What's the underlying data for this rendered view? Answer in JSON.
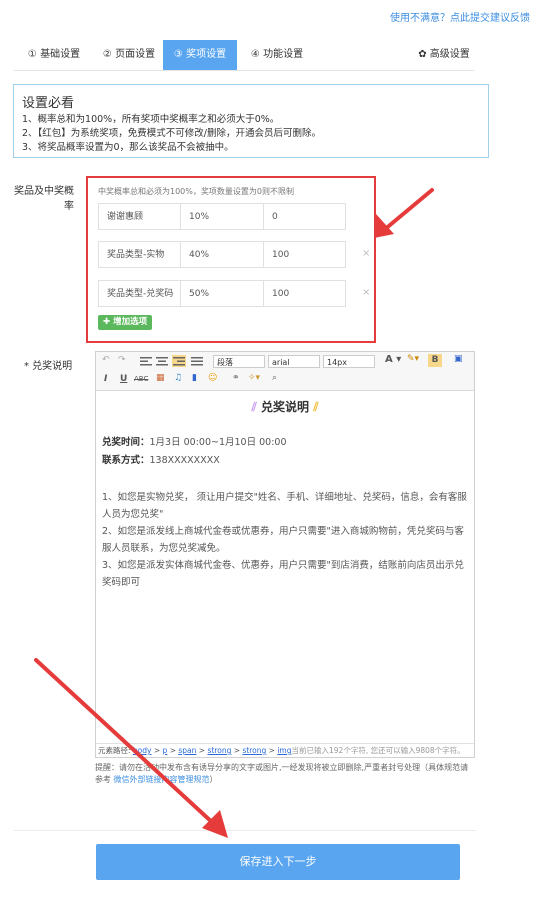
{
  "feedback_link": "使用不满意？点此提交建议反馈",
  "tabs": [
    {
      "label": "① 基础设置"
    },
    {
      "label": "② 页面设置"
    },
    {
      "label": "③ 奖项设置"
    },
    {
      "label": "④ 功能设置"
    }
  ],
  "advanced_tab": "✿ 高级设置",
  "notice": {
    "title": "设置必看",
    "lines": [
      "1、概率总和为100%，所有奖项中奖概率之和必须大于0%。",
      "2、【红包】为系统奖项，免费模式不可修改/删除，开通会员后可删除。",
      "3、将奖品概率设置为0，那么该奖品不会被抽中。"
    ]
  },
  "prize_section": {
    "label_line1": "奖品及中奖概",
    "label_line2": "率",
    "hint": "中奖概率总和必须为100%，奖项数量设置为0则不限制",
    "rows": [
      {
        "name": "谢谢惠顾",
        "prob": "10%",
        "qty": "0",
        "removable": ""
      },
      {
        "name": "奖品类型-实物",
        "prob": "40%",
        "qty": "100",
        "removable": "×"
      },
      {
        "name": "奖品类型-兑奖码",
        "prob": "50%",
        "qty": "100",
        "removable": "×"
      }
    ],
    "add_button": "✚ 增加选项"
  },
  "exchange_label": "* 兑奖说明",
  "editor": {
    "toolbar": {
      "paragraph": "段落",
      "font": "arial",
      "size": "14px",
      "bold": "B",
      "italic": "I",
      "underline": "U",
      "strike": "ABC"
    },
    "content": {
      "title": "兑奖说明",
      "time_label": "兑奖时间：",
      "time_value": "1月3日 00:00~1月10日 00:00",
      "contact_label": "联系方式：",
      "contact_value": "138XXXXXXXX",
      "para1": "1、如您是实物兑奖，  须让用户提交\"姓名、手机、详细地址、兑奖码，信息，会有客服人员为您兑奖\"",
      "para2": "2、如您是派发线上商城代金卷或优惠券，用户只需要\"进入商城购物前，凭兑奖码与客服人员联系，为您兑奖减免。",
      "para3": "3、如您是派发实体商城代金卷、优惠券，用户只需要\"到店消费，结账前向店员出示兑奖码即可"
    },
    "path_prefix": "元素路径: ",
    "path_items": [
      "body",
      "p",
      "span",
      "strong",
      "strong",
      "img"
    ],
    "count_text": "当前已输入192个字符, 您还可以输入9808个字符。"
  },
  "reminder": {
    "text": "提醒：请勿在活动中发布含有诱导分享的文字或图片,一经发现将被立即删除,严重者封号处理（具体规范请参考 ",
    "link": "微信外部链接内容管理规范",
    "end": "）"
  },
  "save_button": "保存进入下一步",
  "colors": {
    "accent": "#5aa5ef",
    "highlight_border": "#e53b3b",
    "add_green": "#5cb85c"
  }
}
